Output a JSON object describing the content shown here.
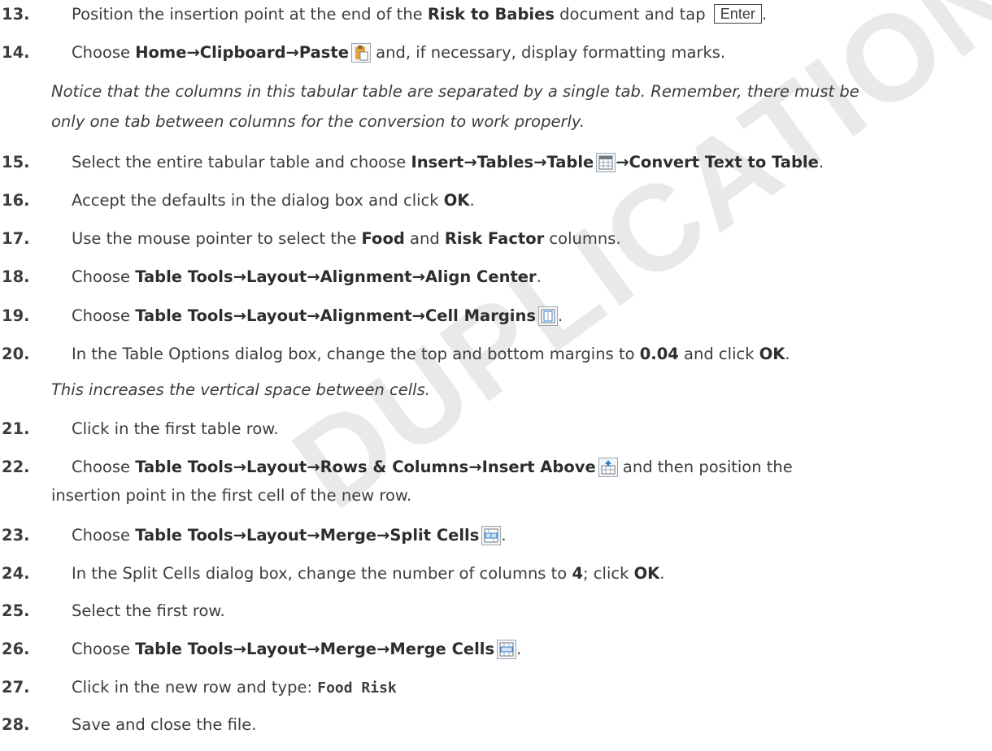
{
  "watermark": "DUPLICATION ONLY",
  "steps": [
    {
      "num": "13.",
      "pre": "Position the insertion point at the end of the ",
      "b1": "Risk to Babies",
      "mid": " document and tap ",
      "key": "Enter",
      "post": "."
    },
    {
      "num": "14.",
      "pre": "Choose ",
      "b1": "Home→Clipboard→Paste",
      "post": " and, if necessary, display formatting marks."
    },
    {
      "note1": "Notice that the columns in this tabular table are separated by a single tab. Remember, there must be",
      "note2": "only one tab between columns for the conversion to work properly."
    },
    {
      "num": "15.",
      "pre": "Select the entire tabular table and choose ",
      "b1": "Insert→Tables→Table",
      "b2": "→Convert Text to Table",
      "post": "."
    },
    {
      "num": "16.",
      "pre": "Accept the defaults in the dialog box and click ",
      "b1": "OK",
      "post": "."
    },
    {
      "num": "17.",
      "pre": "Use the mouse pointer to select the ",
      "b1": "Food",
      "mid": " and ",
      "b2": "Risk Factor",
      "post": " columns."
    },
    {
      "num": "18.",
      "pre": "Choose ",
      "b1": "Table Tools→Layout→Alignment→Align Center",
      "post": "."
    },
    {
      "num": "19.",
      "pre": "Choose ",
      "b1": "Table Tools→Layout→Alignment→Cell Margins",
      "post": "."
    },
    {
      "num": "20.",
      "pre": "In the Table Options dialog box, change the top and bottom margins to ",
      "b1": "0.04",
      "mid": " and click ",
      "b2": "OK",
      "post": "."
    },
    {
      "note1": "This increases the vertical space between cells."
    },
    {
      "num": "21.",
      "pre": "Click in the first table row."
    },
    {
      "num": "22.",
      "pre": "Choose ",
      "b1": "Table Tools→Layout→Rows & Columns→Insert Above",
      "post": " and then position the",
      "cont": "insertion point in the first cell of the new row."
    },
    {
      "num": "23.",
      "pre": "Choose ",
      "b1": "Table Tools→Layout→Merge→Split Cells",
      "post": "."
    },
    {
      "num": "24.",
      "pre": "In the Split Cells dialog box, change the number of columns to ",
      "b1": "4",
      "mid": "; click ",
      "b2": "OK",
      "post": "."
    },
    {
      "num": "25.",
      "pre": "Select the first row."
    },
    {
      "num": "26.",
      "pre": "Choose ",
      "b1": "Table Tools→Layout→Merge→Merge Cells",
      "post": "."
    },
    {
      "num": "27.",
      "pre": "Click in the new row and type: ",
      "code": "Food Risk"
    },
    {
      "num": "28.",
      "pre": "Save and close the file."
    }
  ],
  "icons": {
    "paste": "paste-icon",
    "table": "table-icon",
    "cell_margins": "cell-margins-icon",
    "insert_above": "insert-above-icon",
    "split_cells": "split-cells-icon",
    "merge_cells": "merge-cells-icon"
  },
  "colors": {
    "text": "#3c3c3c",
    "bold_text": "#2d2d2d",
    "watermark": "#e9e9e9",
    "icon_blue": "#2f7fd0",
    "icon_orange": "#e2a23a"
  }
}
